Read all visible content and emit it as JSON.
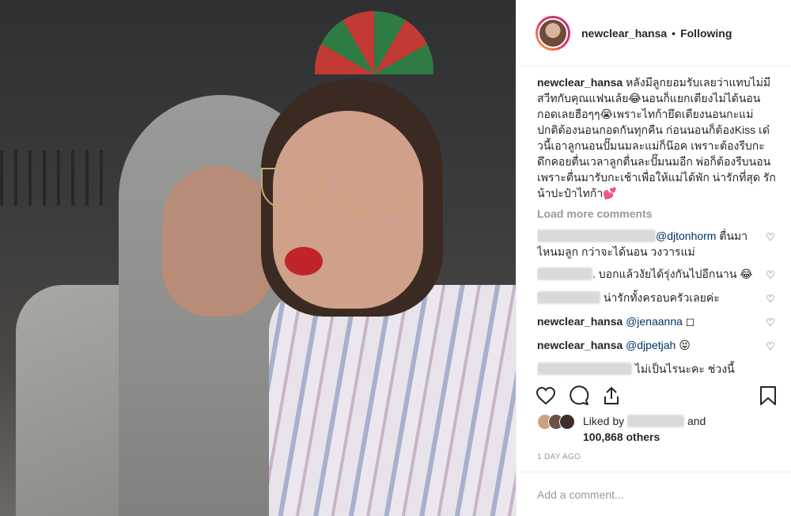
{
  "post": {
    "username": "newclear_hansa",
    "follow_state": "Following",
    "separator": "•",
    "caption": "หลังมีลูกยอมรับเลยว่าแทบไม่มีสวีทกับคุณแฟนเล้ย😂นอนก็แยกเตียงไม่ได้นอนกอดเลยฮือๆๆ😭เพราะไทก้ายึดเตียงนอนกะแม่ ปกติต้องนอนกอดกันทุกคืน ก่อนนอนก็ต้องKiss เด๋วนี้เอาลูกนอนปั๊มนมละแม่ก็น๊อค เพราะต้องรีบกะดึกคอยตื่นเวลาลูกตื่นละปั๊มนมอีก พ่อก็ต้องรีบนอนเพราะตื่นมารับกะเช้าเพื่อให้แม่ได้พัก น่ารักที่สุด รักน้าปะป๋าไทก้า💕",
    "load_more": "Load more comments",
    "comments": [
      {
        "user": "",
        "mention": "@djtonhorm",
        "text": " ตื่นมาไหนมลูก กว่าจะได้นอน วงวารแม่",
        "blurred": true
      },
      {
        "user": "",
        "mention": "",
        "text": ". บอกแล้วงัยได้รุ่งกันไปอีกนาน 😂",
        "blurred": true
      },
      {
        "user": "",
        "mention": "",
        "text": " น่ารักทั้งครอบครัวเลยค่ะ",
        "blurred": true
      },
      {
        "user": "newclear_hansa",
        "mention": "@jenaanna",
        "text": " ◻",
        "blurred": false
      },
      {
        "user": "newclear_hansa",
        "mention": "@djpetjah",
        "text": " 😝",
        "blurred": false
      },
      {
        "user": "",
        "mention": "",
        "text": "ไม่เป็นไรนะคะ ช่วงนี้",
        "blurred": true
      }
    ],
    "liked_by_label": "Liked by",
    "liked_and": "and",
    "likes_count": "100,868 others",
    "timestamp": "1 DAY AGO",
    "add_comment_placeholder": "Add a comment..."
  },
  "colors": {
    "text": "#262626",
    "muted": "#999999",
    "mention": "#003569",
    "border": "#efefef"
  },
  "icons": [
    "heart-icon",
    "comment-icon",
    "share-icon",
    "bookmark-icon"
  ]
}
